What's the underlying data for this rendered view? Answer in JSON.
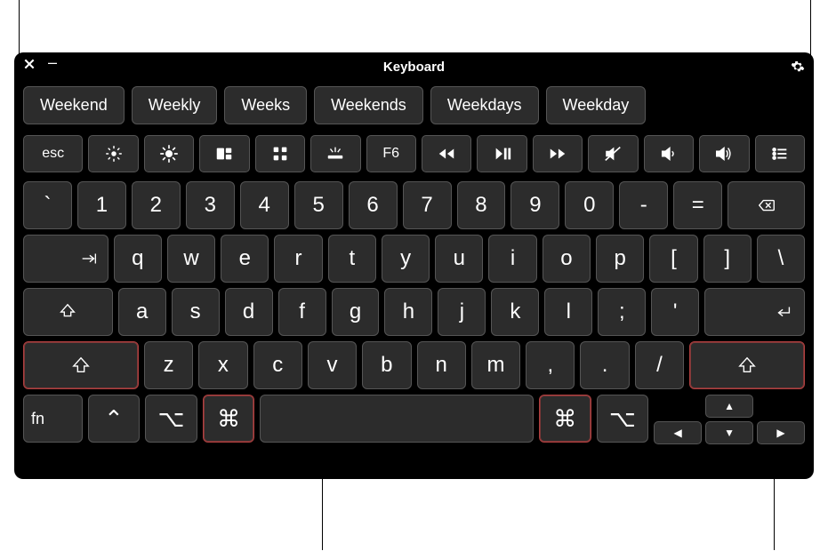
{
  "window": {
    "title": "Keyboard"
  },
  "suggestions": [
    "Weekend",
    "Weekly",
    "Weeks",
    "Weekends",
    "Weekdays",
    "Weekday"
  ],
  "function_row": {
    "esc": "esc",
    "f6": "F6"
  },
  "rows": {
    "num": [
      "`",
      "1",
      "2",
      "3",
      "4",
      "5",
      "6",
      "7",
      "8",
      "9",
      "0",
      "-",
      "="
    ],
    "q": [
      "q",
      "w",
      "e",
      "r",
      "t",
      "y",
      "u",
      "i",
      "o",
      "p",
      "[",
      "]",
      "\\"
    ],
    "a": [
      "a",
      "s",
      "d",
      "f",
      "g",
      "h",
      "j",
      "k",
      "l",
      ";",
      "'"
    ],
    "z": [
      "z",
      "x",
      "c",
      "v",
      "b",
      "n",
      "m",
      ",",
      ".",
      "/"
    ]
  },
  "bottom": {
    "fn": "fn"
  }
}
